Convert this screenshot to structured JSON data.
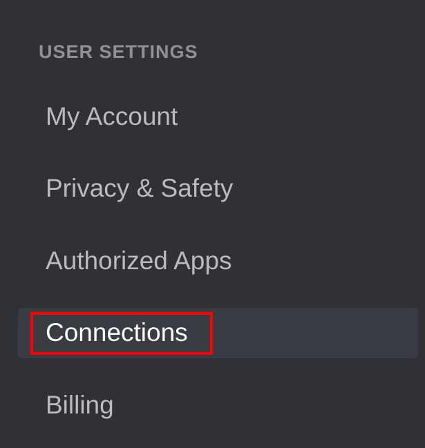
{
  "sidebar": {
    "section_header": "USER SETTINGS",
    "items": [
      {
        "label": "My Account",
        "selected": false
      },
      {
        "label": "Privacy & Safety",
        "selected": false
      },
      {
        "label": "Authorized Apps",
        "selected": false
      },
      {
        "label": "Connections",
        "selected": true
      },
      {
        "label": "Billing",
        "selected": false
      }
    ]
  }
}
